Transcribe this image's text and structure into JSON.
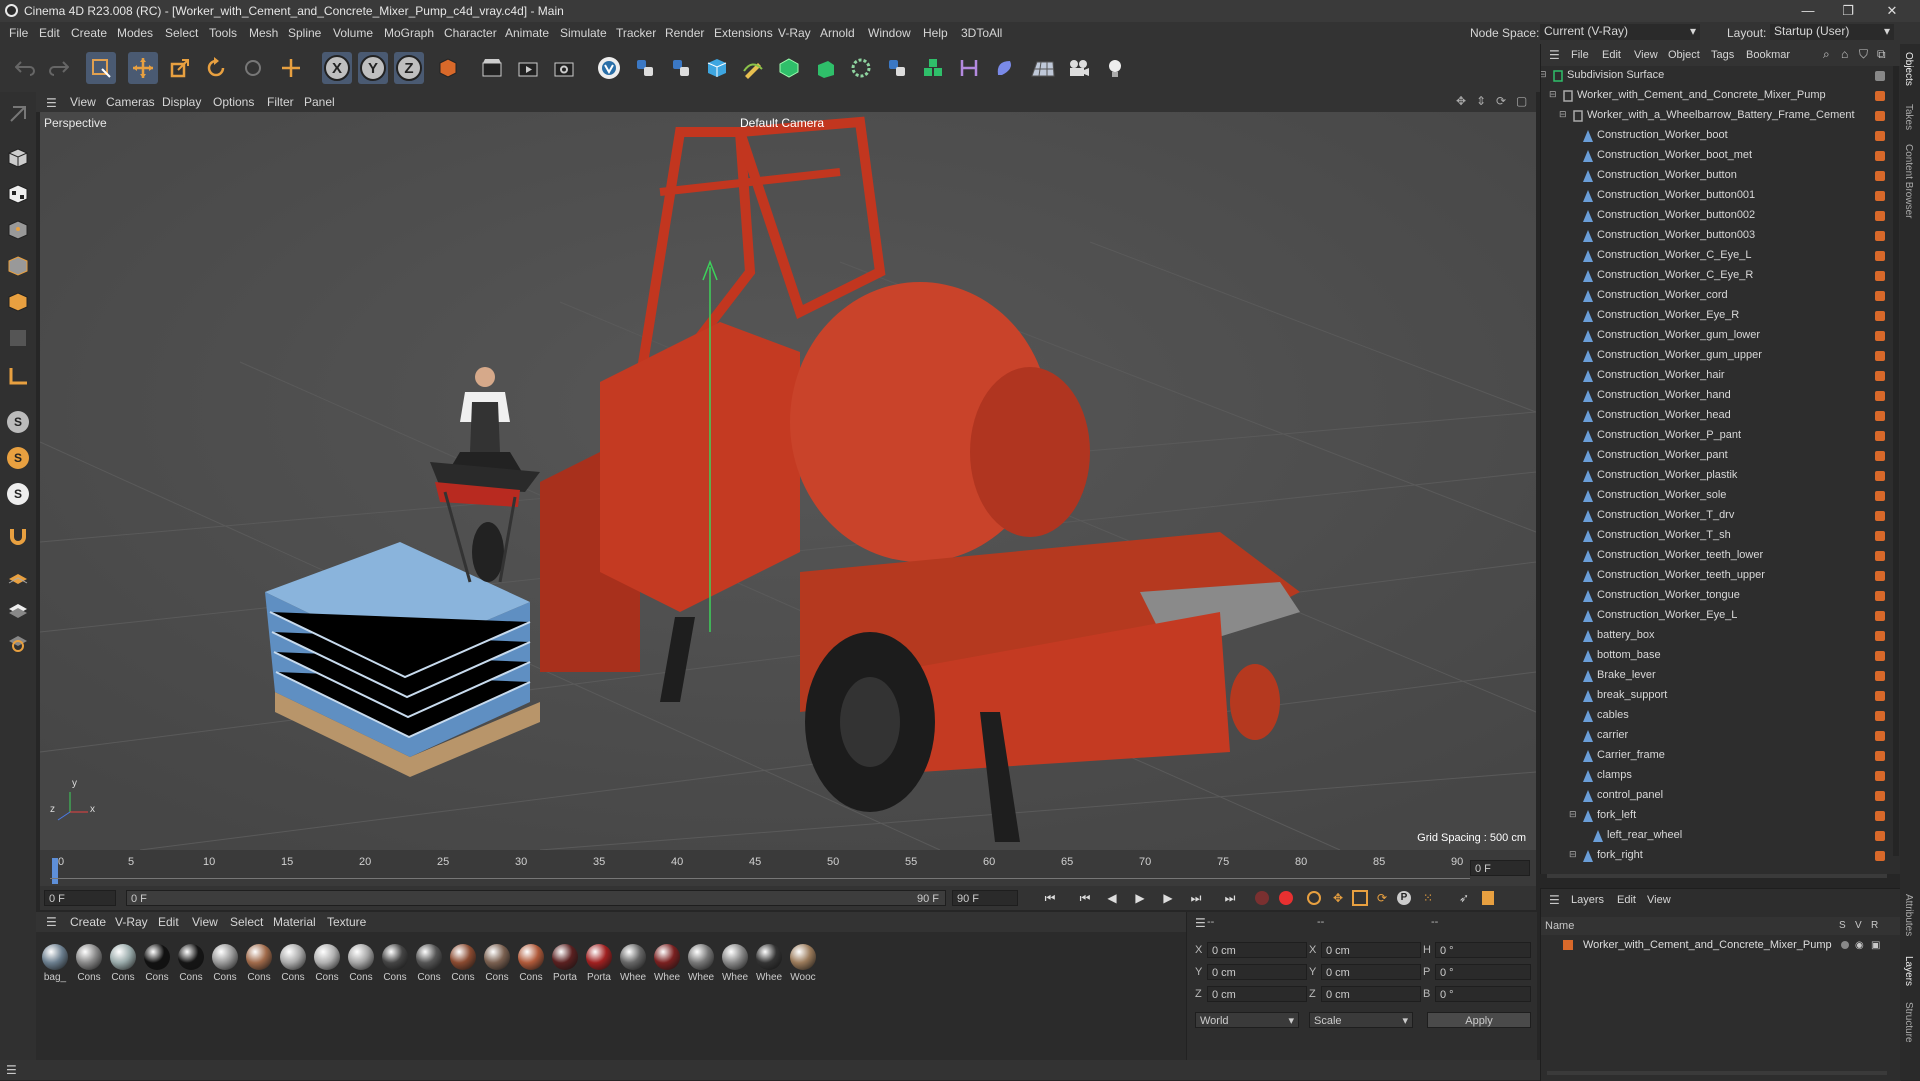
{
  "window": {
    "title": "Cinema 4D R23.008 (RC) - [Worker_with_Cement_and_Concrete_Mixer_Pump_c4d_vray.c4d] - Main",
    "minimize": "—",
    "maximize": "❐",
    "close": "✕"
  },
  "menubar": {
    "items": [
      "File",
      "Edit",
      "Create",
      "Modes",
      "Select",
      "Tools",
      "Mesh",
      "Spline",
      "Volume",
      "MoGraph",
      "Character",
      "Animate",
      "Simulate",
      "Tracker",
      "Render",
      "Extensions",
      "V-Ray",
      "Arnold",
      "Window",
      "Help",
      "3DToAll"
    ],
    "node_space_label": "Node Space:",
    "node_space_value": "Current (V-Ray)",
    "layout_label": "Layout:",
    "layout_value": "Startup (User)"
  },
  "viewport": {
    "menu": [
      "View",
      "Cameras",
      "Display",
      "Options",
      "Filter",
      "Panel"
    ],
    "label": "Perspective",
    "camera": "Default Camera",
    "grid_spacing": "Grid Spacing : 500 cm",
    "axis_y": "y",
    "axis_z": "z",
    "axis_x": "x"
  },
  "timeline": {
    "ticks": [
      "0",
      "5",
      "10",
      "15",
      "20",
      "25",
      "30",
      "35",
      "40",
      "45",
      "50",
      "55",
      "60",
      "65",
      "70",
      "75",
      "80",
      "85",
      "90"
    ],
    "frame_end_field": "0 F",
    "current_frame": "0 F",
    "range_start": "0 F",
    "range_end": "90 F",
    "max_frame": "90 F"
  },
  "material_manager": {
    "menu": [
      "Create",
      "V-Ray",
      "Edit",
      "View",
      "Select",
      "Material",
      "Texture"
    ],
    "materials": [
      {
        "label": "bag_",
        "color": "#6b7e8e"
      },
      {
        "label": "Cons",
        "color": "#888"
      },
      {
        "label": "Cons",
        "color": "#9aa"
      },
      {
        "label": "Cons",
        "color": "#111"
      },
      {
        "label": "Cons",
        "color": "#151515"
      },
      {
        "label": "Cons",
        "color": "#999"
      },
      {
        "label": "Cons",
        "color": "#a06a4a"
      },
      {
        "label": "Cons",
        "color": "#aaa"
      },
      {
        "label": "Cons",
        "color": "#b0b0b0"
      },
      {
        "label": "Cons",
        "color": "#a5a5a5"
      },
      {
        "label": "Cons",
        "color": "#444"
      },
      {
        "label": "Cons",
        "color": "#555"
      },
      {
        "label": "Cons",
        "color": "#8a4a30"
      },
      {
        "label": "Cons",
        "color": "#7a6050"
      },
      {
        "label": "Cons",
        "color": "#b05a3a"
      },
      {
        "label": "Porta",
        "color": "#5a2020"
      },
      {
        "label": "Porta",
        "color": "#a02020"
      },
      {
        "label": "Whee",
        "color": "#666"
      },
      {
        "label": "Whee",
        "color": "#7a2020"
      },
      {
        "label": "Whee",
        "color": "#777"
      },
      {
        "label": "Whee",
        "color": "#888"
      },
      {
        "label": "Whee",
        "color": "#333"
      },
      {
        "label": "Wooc",
        "color": "#9a7a5a"
      }
    ]
  },
  "attributes": {
    "header1": "--",
    "header2": "--",
    "header3": "--",
    "x_label": "X",
    "y_label": "Y",
    "z_label": "Z",
    "h_label": "H",
    "p_label": "P",
    "b_label": "B",
    "pos_x": "0 cm",
    "pos_y": "0 cm",
    "pos_z": "0 cm",
    "size_x": "0 cm",
    "size_y": "0 cm",
    "size_z": "0 cm",
    "rot_h": "0 °",
    "rot_p": "0 °",
    "rot_b": "0 °",
    "coord_mode": "World",
    "scale_mode": "Scale",
    "apply": "Apply"
  },
  "object_manager": {
    "menu": [
      "File",
      "Edit",
      "View",
      "Object",
      "Tags",
      "Bookmar"
    ],
    "objects": [
      {
        "name": "Subdivision Surface",
        "level": 0,
        "type": "subd"
      },
      {
        "name": "Worker_with_Cement_and_Concrete_Mixer_Pump",
        "level": 1,
        "type": "null"
      },
      {
        "name": "Worker_with_a_Wheelbarrow_Battery_Frame_Cement",
        "level": 2,
        "type": "null"
      },
      {
        "name": "Construction_Worker_boot",
        "level": 3,
        "type": "mesh"
      },
      {
        "name": "Construction_Worker_boot_met",
        "level": 3,
        "type": "mesh"
      },
      {
        "name": "Construction_Worker_button",
        "level": 3,
        "type": "mesh"
      },
      {
        "name": "Construction_Worker_button001",
        "level": 3,
        "type": "mesh"
      },
      {
        "name": "Construction_Worker_button002",
        "level": 3,
        "type": "mesh"
      },
      {
        "name": "Construction_Worker_button003",
        "level": 3,
        "type": "mesh"
      },
      {
        "name": "Construction_Worker_C_Eye_L",
        "level": 3,
        "type": "mesh"
      },
      {
        "name": "Construction_Worker_C_Eye_R",
        "level": 3,
        "type": "mesh"
      },
      {
        "name": "Construction_Worker_cord",
        "level": 3,
        "type": "mesh"
      },
      {
        "name": "Construction_Worker_Eye_R",
        "level": 3,
        "type": "mesh"
      },
      {
        "name": "Construction_Worker_gum_lower",
        "level": 3,
        "type": "mesh"
      },
      {
        "name": "Construction_Worker_gum_upper",
        "level": 3,
        "type": "mesh"
      },
      {
        "name": "Construction_Worker_hair",
        "level": 3,
        "type": "mesh"
      },
      {
        "name": "Construction_Worker_hand",
        "level": 3,
        "type": "mesh"
      },
      {
        "name": "Construction_Worker_head",
        "level": 3,
        "type": "mesh"
      },
      {
        "name": "Construction_Worker_P_pant",
        "level": 3,
        "type": "mesh"
      },
      {
        "name": "Construction_Worker_pant",
        "level": 3,
        "type": "mesh"
      },
      {
        "name": "Construction_Worker_plastik",
        "level": 3,
        "type": "mesh"
      },
      {
        "name": "Construction_Worker_sole",
        "level": 3,
        "type": "mesh"
      },
      {
        "name": "Construction_Worker_T_drv",
        "level": 3,
        "type": "mesh"
      },
      {
        "name": "Construction_Worker_T_sh",
        "level": 3,
        "type": "mesh"
      },
      {
        "name": "Construction_Worker_teeth_lower",
        "level": 3,
        "type": "mesh"
      },
      {
        "name": "Construction_Worker_teeth_upper",
        "level": 3,
        "type": "mesh"
      },
      {
        "name": "Construction_Worker_tongue",
        "level": 3,
        "type": "mesh"
      },
      {
        "name": "Construction_Worker_Eye_L",
        "level": 3,
        "type": "mesh"
      },
      {
        "name": "battery_box",
        "level": 3,
        "type": "mesh"
      },
      {
        "name": "bottom_base",
        "level": 3,
        "type": "mesh"
      },
      {
        "name": "Brake_lever",
        "level": 3,
        "type": "mesh"
      },
      {
        "name": "break_support",
        "level": 3,
        "type": "mesh"
      },
      {
        "name": "cables",
        "level": 3,
        "type": "mesh"
      },
      {
        "name": "carrier",
        "level": 3,
        "type": "mesh"
      },
      {
        "name": "Carrier_frame",
        "level": 3,
        "type": "mesh"
      },
      {
        "name": "clamps",
        "level": 3,
        "type": "mesh"
      },
      {
        "name": "control_panel",
        "level": 3,
        "type": "mesh"
      },
      {
        "name": "fork_left",
        "level": 3,
        "type": "mesh"
      },
      {
        "name": "left_rear_wheel",
        "level": 4,
        "type": "mesh"
      },
      {
        "name": "fork_right",
        "level": 3,
        "type": "mesh"
      }
    ]
  },
  "layer_manager": {
    "menu": [
      "Layers",
      "Edit",
      "View"
    ],
    "col_name": "Name",
    "col_s": "S",
    "col_v": "V",
    "col_r": "R",
    "layers": [
      {
        "name": "Worker_with_Cement_and_Concrete_Mixer_Pump",
        "color": "#d9692a"
      }
    ]
  },
  "right_tabs": [
    "Objects",
    "Takes",
    "Content Browser",
    "Attributes",
    "Layers",
    "Structure"
  ],
  "colors": {
    "accent": "#d9692a",
    "active_tool": "#4a5a72",
    "viewport_bg": "#4e4e4e"
  }
}
